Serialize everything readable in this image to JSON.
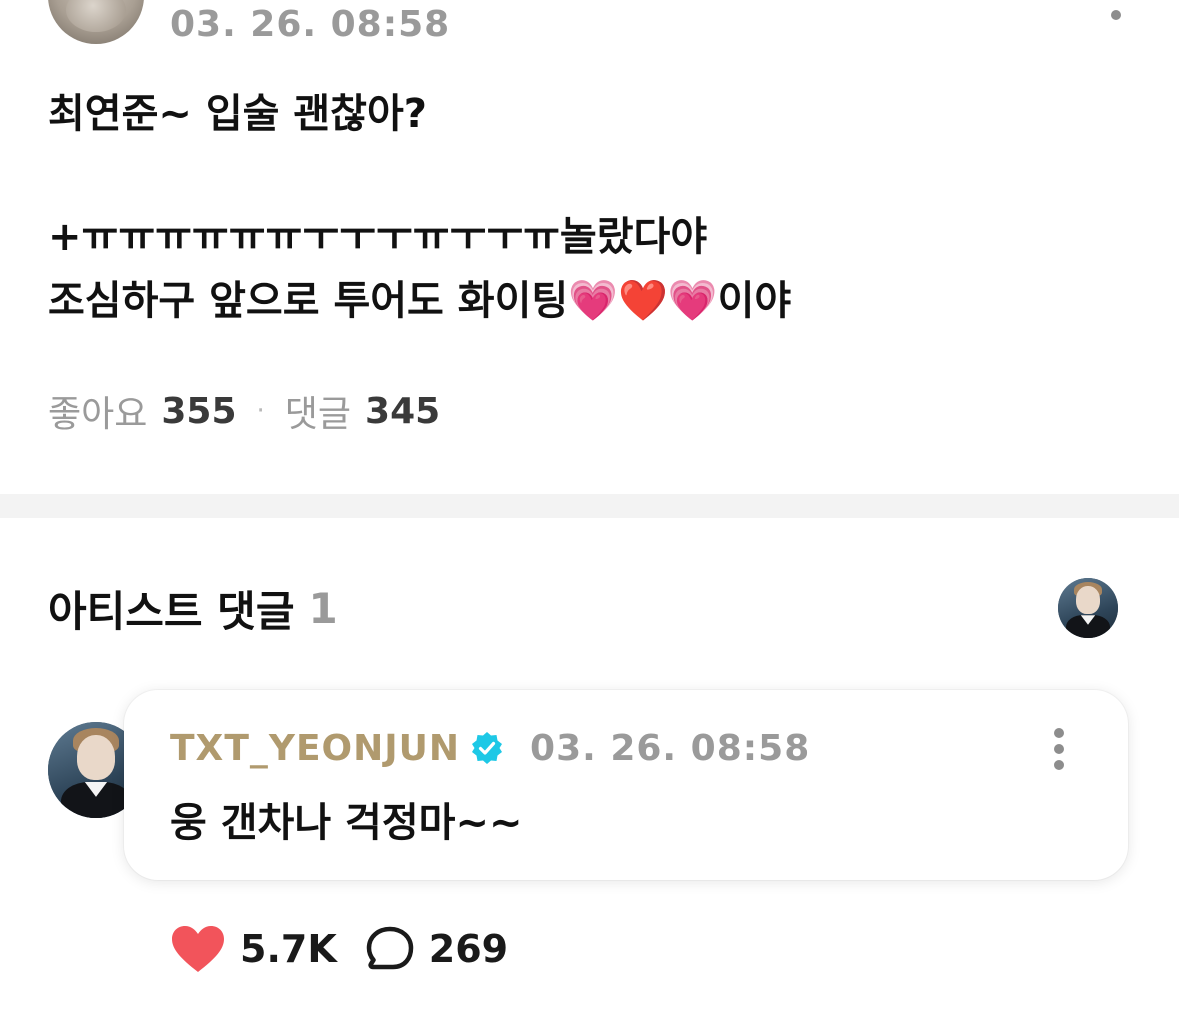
{
  "post": {
    "timestamp": "03. 26. 08:58",
    "line1": "최연준~ 입술 괜찮아?",
    "line2": "+ㅠㅠㅠㅠㅠㅠㅜㅜㅜㅠㅜㅜㅠ놀랐다야",
    "line3": "조심하구 앞으로 투어도 화이팅💗❤️💗이야",
    "likes_label": "좋아요",
    "likes_count": "355",
    "separator": "·",
    "comments_label": "댓글",
    "comments_count": "345"
  },
  "artist_section": {
    "title": "아티스트 댓글",
    "count": "1"
  },
  "artist_comment": {
    "author": "TXT_YEONJUN",
    "timestamp": "03. 26. 08:58",
    "text": "웅 갠차나 걱정마~~",
    "like_count": "5.7K",
    "reply_count": "269"
  },
  "colors": {
    "artist_name": "#b09a6e",
    "verified_badge": "#1ec8e6",
    "heart": "#f2545b",
    "muted_text": "#9a9a9a"
  },
  "icons": [
    "more-vertical-icon",
    "verified-badge-icon",
    "heart-icon",
    "comment-bubble-icon"
  ]
}
